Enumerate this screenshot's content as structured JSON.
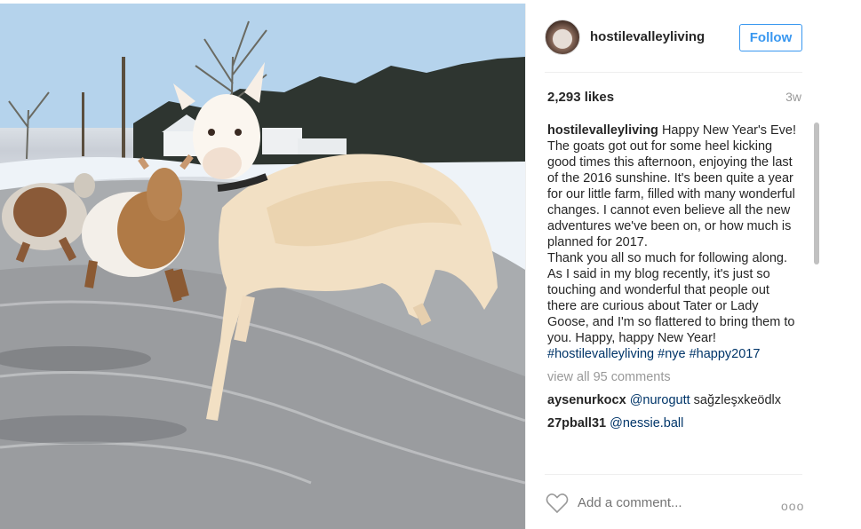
{
  "post": {
    "username": "hostilevalleyliving",
    "follow_label": "Follow",
    "likes": "2,293 likes",
    "age": "3w",
    "caption_user": "hostilevalleyliving",
    "caption_text": " Happy New Year's Eve!\nThe goats got out for some heel kicking good times this afternoon, enjoying the last of the 2016 sunshine. It's been quite a year for our little farm, filled with many wonderful changes. I cannot even believe all the new adventures we've been on, or how much is planned for 2017.\nThank you all so much for following along. As I said in my blog recently, it's just so touching and wonderful that people out there are curious about Tater or Lady Goose, and I'm so flattered to bring them to you. Happy, happy New Year!",
    "hashtags": [
      "#hostilevalleyliving",
      "#nye",
      "#happy2017"
    ],
    "view_all": "view all 95 comments",
    "comments": [
      {
        "user": "aysenurkocx",
        "mention": "@nurogutt",
        "text": " sağzleşxkeödlx"
      },
      {
        "user": "27pball31",
        "mention": "@nessie.ball",
        "text": ""
      }
    ],
    "add_comment_placeholder": "Add a comment...",
    "more_label": "ooo"
  },
  "colors": {
    "accent": "#3897f0",
    "hashtag": "#003569",
    "muted": "#999999"
  },
  "icons": {
    "like": "heart-outline-icon",
    "more": "more-options-icon"
  }
}
